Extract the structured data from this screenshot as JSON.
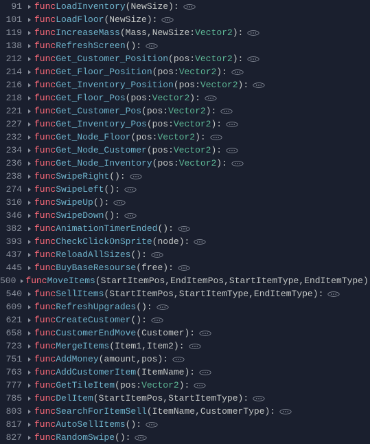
{
  "keyword_func": "func",
  "type_vector2": "Vector2",
  "lines": [
    {
      "ln": "91",
      "name": "LoadInventory",
      "sig": [
        {
          "t": "p",
          "v": "("
        },
        {
          "t": "param",
          "v": "NewSize"
        },
        {
          "t": "p",
          "v": ")"
        },
        {
          "t": "c",
          "v": ":"
        }
      ]
    },
    {
      "ln": "101",
      "name": "LoadFloor",
      "sig": [
        {
          "t": "p",
          "v": "("
        },
        {
          "t": "param",
          "v": "NewSize"
        },
        {
          "t": "p",
          "v": ")"
        },
        {
          "t": "c",
          "v": ":"
        }
      ]
    },
    {
      "ln": "119",
      "name": "IncreaseMass",
      "sig": [
        {
          "t": "p",
          "v": "("
        },
        {
          "t": "param",
          "v": "Mass"
        },
        {
          "t": "cm",
          "v": ","
        },
        {
          "t": "param",
          "v": "NewSize"
        },
        {
          "t": "c",
          "v": ":"
        },
        {
          "t": "type",
          "v": "Vector2"
        },
        {
          "t": "p",
          "v": ")"
        },
        {
          "t": "c",
          "v": ":"
        }
      ]
    },
    {
      "ln": "138",
      "name": "RefreshScreen",
      "sig": [
        {
          "t": "p",
          "v": "("
        },
        {
          "t": "p",
          "v": ")"
        },
        {
          "t": "c",
          "v": ":"
        }
      ]
    },
    {
      "ln": "212",
      "name": "Get_Customer_Position",
      "sig": [
        {
          "t": "p",
          "v": "("
        },
        {
          "t": "param",
          "v": "pos"
        },
        {
          "t": "c",
          "v": ":"
        },
        {
          "t": "type",
          "v": "Vector2"
        },
        {
          "t": "p",
          "v": ")"
        },
        {
          "t": "c",
          "v": ":"
        }
      ]
    },
    {
      "ln": "214",
      "name": "Get_Floor_Position",
      "sig": [
        {
          "t": "p",
          "v": "("
        },
        {
          "t": "param",
          "v": "pos"
        },
        {
          "t": "c",
          "v": ":"
        },
        {
          "t": "type",
          "v": "Vector2"
        },
        {
          "t": "p",
          "v": ")"
        },
        {
          "t": "c",
          "v": ":"
        }
      ]
    },
    {
      "ln": "216",
      "name": "Get_Inventory_Position",
      "sig": [
        {
          "t": "p",
          "v": "("
        },
        {
          "t": "param",
          "v": "pos"
        },
        {
          "t": "c",
          "v": ":"
        },
        {
          "t": "type",
          "v": "Vector2"
        },
        {
          "t": "p",
          "v": ")"
        },
        {
          "t": "c",
          "v": ":"
        }
      ]
    },
    {
      "ln": "218",
      "name": "Get_Floor_Pos",
      "sig": [
        {
          "t": "p",
          "v": "("
        },
        {
          "t": "param",
          "v": "pos"
        },
        {
          "t": "c",
          "v": ":"
        },
        {
          "t": "type",
          "v": "Vector2"
        },
        {
          "t": "p",
          "v": ")"
        },
        {
          "t": "c",
          "v": ":"
        }
      ]
    },
    {
      "ln": "221",
      "name": "Get_Customer_Pos",
      "sig": [
        {
          "t": "p",
          "v": "("
        },
        {
          "t": "param",
          "v": "pos"
        },
        {
          "t": "c",
          "v": ":"
        },
        {
          "t": "type",
          "v": "Vector2"
        },
        {
          "t": "p",
          "v": ")"
        },
        {
          "t": "c",
          "v": ":"
        }
      ]
    },
    {
      "ln": "227",
      "name": "Get_Inventory_Pos",
      "sig": [
        {
          "t": "p",
          "v": "("
        },
        {
          "t": "param",
          "v": "pos"
        },
        {
          "t": "c",
          "v": ":"
        },
        {
          "t": "type",
          "v": "Vector2"
        },
        {
          "t": "p",
          "v": ")"
        },
        {
          "t": "c",
          "v": ":"
        }
      ]
    },
    {
      "ln": "232",
      "name": "Get_Node_Floor",
      "sig": [
        {
          "t": "p",
          "v": "("
        },
        {
          "t": "param",
          "v": "pos"
        },
        {
          "t": "c",
          "v": ":"
        },
        {
          "t": "type",
          "v": "Vector2"
        },
        {
          "t": "p",
          "v": ")"
        },
        {
          "t": "c",
          "v": ":"
        }
      ]
    },
    {
      "ln": "234",
      "name": "Get_Node_Customer",
      "sig": [
        {
          "t": "p",
          "v": "("
        },
        {
          "t": "param",
          "v": "pos"
        },
        {
          "t": "c",
          "v": ":"
        },
        {
          "t": "type",
          "v": "Vector2"
        },
        {
          "t": "p",
          "v": ")"
        },
        {
          "t": "c",
          "v": ":"
        }
      ]
    },
    {
      "ln": "236",
      "name": "Get_Node_Inventory",
      "sig": [
        {
          "t": "p",
          "v": "("
        },
        {
          "t": "param",
          "v": "pos"
        },
        {
          "t": "c",
          "v": ":"
        },
        {
          "t": "type",
          "v": "Vector2"
        },
        {
          "t": "p",
          "v": ")"
        },
        {
          "t": "c",
          "v": ":"
        }
      ]
    },
    {
      "ln": "238",
      "name": "SwipeRight",
      "sig": [
        {
          "t": "p",
          "v": "("
        },
        {
          "t": "p",
          "v": ")"
        },
        {
          "t": "c",
          "v": ":"
        }
      ]
    },
    {
      "ln": "274",
      "name": "SwipeLeft",
      "sig": [
        {
          "t": "p",
          "v": "("
        },
        {
          "t": "p",
          "v": ")"
        },
        {
          "t": "c",
          "v": ":"
        }
      ]
    },
    {
      "ln": "310",
      "name": "SwipeUp",
      "sig": [
        {
          "t": "p",
          "v": "("
        },
        {
          "t": "p",
          "v": ")"
        },
        {
          "t": "c",
          "v": ":"
        }
      ]
    },
    {
      "ln": "346",
      "name": "SwipeDown",
      "sig": [
        {
          "t": "p",
          "v": "("
        },
        {
          "t": "p",
          "v": ")"
        },
        {
          "t": "c",
          "v": ":"
        }
      ]
    },
    {
      "ln": "382",
      "name": "AnimationTimerEnded",
      "sig": [
        {
          "t": "p",
          "v": "("
        },
        {
          "t": "p",
          "v": ")"
        },
        {
          "t": "c",
          "v": ":"
        }
      ]
    },
    {
      "ln": "393",
      "name": "CheckClickOnSprite",
      "sig": [
        {
          "t": "p",
          "v": "("
        },
        {
          "t": "param",
          "v": "node"
        },
        {
          "t": "p",
          "v": ")"
        },
        {
          "t": "c",
          "v": ":"
        }
      ]
    },
    {
      "ln": "437",
      "name": "ReloadAllSizes",
      "sig": [
        {
          "t": "p",
          "v": "("
        },
        {
          "t": "p",
          "v": ")"
        },
        {
          "t": "c",
          "v": ":"
        }
      ]
    },
    {
      "ln": "445",
      "name": "BuyBaseResourse",
      "sig": [
        {
          "t": "p",
          "v": "("
        },
        {
          "t": "param",
          "v": "free"
        },
        {
          "t": "p",
          "v": ")"
        },
        {
          "t": "c",
          "v": ":"
        }
      ]
    },
    {
      "ln": "500",
      "name": "MoveItems",
      "sig": [
        {
          "t": "p",
          "v": "("
        },
        {
          "t": "param",
          "v": "StartItemPos"
        },
        {
          "t": "cm",
          "v": ","
        },
        {
          "t": "param",
          "v": "EndItemPos"
        },
        {
          "t": "cm",
          "v": ","
        },
        {
          "t": "param",
          "v": "StartItemType"
        },
        {
          "t": "cm",
          "v": ","
        },
        {
          "t": "param",
          "v": "EndItemType"
        },
        {
          "t": "p",
          "v": ")"
        },
        {
          "t": "c",
          "v": ":"
        }
      ]
    },
    {
      "ln": "540",
      "name": "SellItems",
      "sig": [
        {
          "t": "p",
          "v": "("
        },
        {
          "t": "param",
          "v": "StartItemPos"
        },
        {
          "t": "cm",
          "v": ","
        },
        {
          "t": "param",
          "v": "StartItemType"
        },
        {
          "t": "cm",
          "v": ","
        },
        {
          "t": "param",
          "v": "EndItemType"
        },
        {
          "t": "p",
          "v": ")"
        },
        {
          "t": "c",
          "v": ":"
        }
      ]
    },
    {
      "ln": "609",
      "name": "RefreshUpgrades",
      "sig": [
        {
          "t": "p",
          "v": "("
        },
        {
          "t": "p",
          "v": ")"
        },
        {
          "t": "c",
          "v": ":"
        }
      ]
    },
    {
      "ln": "621",
      "name": "CreateCustomer",
      "sig": [
        {
          "t": "p",
          "v": "("
        },
        {
          "t": "p",
          "v": ")"
        },
        {
          "t": "c",
          "v": ":"
        }
      ]
    },
    {
      "ln": "658",
      "name": "CustomerEndMove",
      "sig": [
        {
          "t": "p",
          "v": "("
        },
        {
          "t": "param",
          "v": "Customer"
        },
        {
          "t": "p",
          "v": ")"
        },
        {
          "t": "c",
          "v": ":"
        }
      ]
    },
    {
      "ln": "723",
      "name": "MergeItems",
      "sig": [
        {
          "t": "p",
          "v": "("
        },
        {
          "t": "param",
          "v": "Item1"
        },
        {
          "t": "cm",
          "v": ","
        },
        {
          "t": "param",
          "v": "Item2"
        },
        {
          "t": "p",
          "v": ")"
        },
        {
          "t": "c",
          "v": ":"
        }
      ]
    },
    {
      "ln": "751",
      "name": "AddMoney",
      "sig": [
        {
          "t": "p",
          "v": "("
        },
        {
          "t": "param",
          "v": "amount"
        },
        {
          "t": "cm",
          "v": ","
        },
        {
          "t": "param",
          "v": "pos"
        },
        {
          "t": "p",
          "v": ")"
        },
        {
          "t": "c",
          "v": ":"
        }
      ]
    },
    {
      "ln": "763",
      "name": "AddCustomerItem",
      "sig": [
        {
          "t": "p",
          "v": "("
        },
        {
          "t": "param",
          "v": "ItemName"
        },
        {
          "t": "p",
          "v": ")"
        },
        {
          "t": "c",
          "v": ":"
        }
      ]
    },
    {
      "ln": "777",
      "name": "GetTileItem",
      "sig": [
        {
          "t": "p",
          "v": "("
        },
        {
          "t": "param",
          "v": "pos"
        },
        {
          "t": "c",
          "v": ":"
        },
        {
          "t": "type",
          "v": "Vector2"
        },
        {
          "t": "p",
          "v": ")"
        },
        {
          "t": "c",
          "v": ":"
        }
      ]
    },
    {
      "ln": "785",
      "name": "DelItem",
      "sig": [
        {
          "t": "p",
          "v": "("
        },
        {
          "t": "param",
          "v": "StartItemPos"
        },
        {
          "t": "cm",
          "v": ","
        },
        {
          "t": "param",
          "v": "StartItemType"
        },
        {
          "t": "p",
          "v": ")"
        },
        {
          "t": "c",
          "v": ":"
        }
      ]
    },
    {
      "ln": "803",
      "name": "SearchForItemSell",
      "sig": [
        {
          "t": "p",
          "v": "("
        },
        {
          "t": "param",
          "v": "ItemName"
        },
        {
          "t": "cm",
          "v": ","
        },
        {
          "t": "param",
          "v": "CustomerType"
        },
        {
          "t": "p",
          "v": ")"
        },
        {
          "t": "c",
          "v": ":"
        }
      ]
    },
    {
      "ln": "817",
      "name": "AutoSellItems",
      "sig": [
        {
          "t": "p",
          "v": "("
        },
        {
          "t": "p",
          "v": ")"
        },
        {
          "t": "c",
          "v": ":"
        }
      ]
    },
    {
      "ln": "827",
      "name": "RandomSwipe",
      "sig": [
        {
          "t": "p",
          "v": "("
        },
        {
          "t": "p",
          "v": ")"
        },
        {
          "t": "c",
          "v": ":"
        }
      ]
    }
  ]
}
